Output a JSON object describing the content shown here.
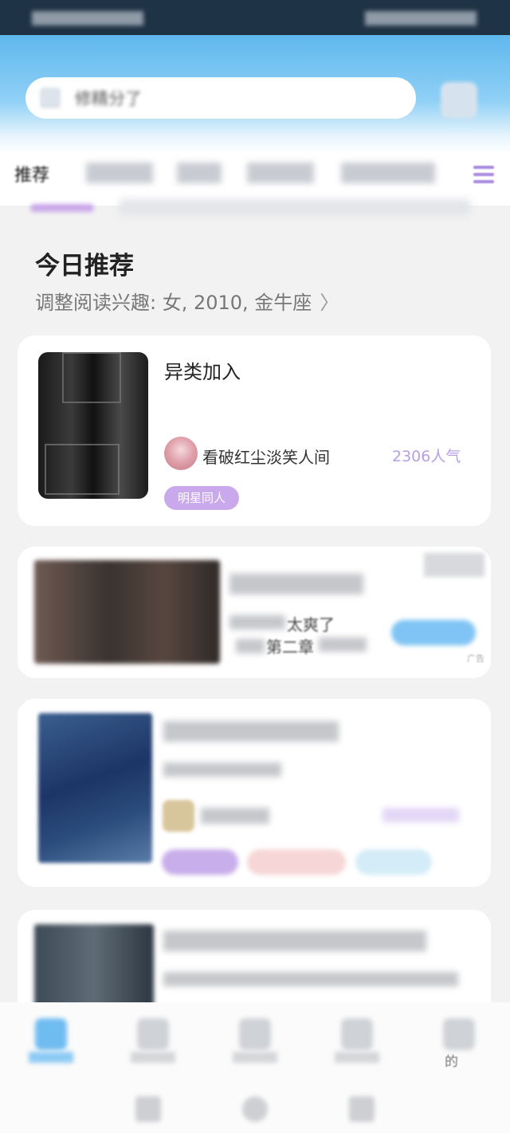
{
  "search": {
    "placeholder_fragment": "精分了"
  },
  "tabs": {
    "first_label": "推荐"
  },
  "recommend": {
    "title": "今日推荐",
    "interest_label": "调整阅读兴趣: 女, 2010, 金牛座",
    "arrow": "〉"
  },
  "book1": {
    "title": "异类加入",
    "author": "看破红尘淡笑人间",
    "popularity": "2306人气",
    "tag": "明星同人"
  },
  "ad": {
    "line1_fragment": "太爽了",
    "line2_fragment": "第二章",
    "label": "广告"
  },
  "bottom_nav": {
    "mine_fragment": "的"
  },
  "colors": {
    "header_blue": "#5fb8ee",
    "accent_purple": "#b79ee6",
    "tag_bg": "#c9a8ec",
    "nav_active": "#6fbcf1"
  },
  "icons": [
    "search-icon",
    "scan-icon",
    "tab-menu-icon",
    "chevron-right-icon",
    "home-icon",
    "back-icon",
    "recent-icon"
  ]
}
